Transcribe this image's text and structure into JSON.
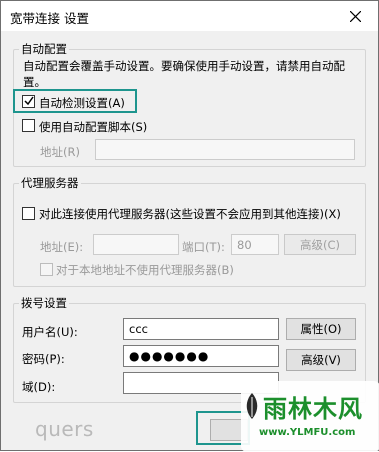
{
  "window": {
    "title": "宽带连接 设置"
  },
  "auto_config": {
    "legend": "自动配置",
    "description": "自动配置会覆盖手动设置。要确保使用手动设置，请禁用自动配置。",
    "auto_detect_label": "自动检测设置(A)",
    "auto_detect_checked": true,
    "use_script_label": "使用自动配置脚本(S)",
    "use_script_checked": false,
    "address_label": "地址(R)",
    "address_value": ""
  },
  "proxy": {
    "legend": "代理服务器",
    "use_proxy_label": "对此连接使用代理服务器(这些设置不会应用到其他连接)(X)",
    "use_proxy_checked": false,
    "address_label": "地址(E):",
    "address_value": "",
    "port_label": "端口(T):",
    "port_value": "80",
    "advanced_label": "高级(C)",
    "bypass_label": "对于本地地址不使用代理服务器(B)",
    "bypass_checked": false
  },
  "dialup": {
    "legend": "拨号设置",
    "username_label": "用户名(U):",
    "username_value": "ccc",
    "properties_label": "属性(O)",
    "password_label": "密码(P):",
    "password_value": "●●●●●●●",
    "advanced_label": "高级(V)",
    "domain_label": "域(D):",
    "domain_value": ""
  },
  "watermark": {
    "left_text": "quers",
    "site_name": "雨林木风",
    "site_url": "www.YLMFU.com"
  },
  "colors": {
    "focus": "#1e958e",
    "watermark_green": "#1c8f2c"
  }
}
